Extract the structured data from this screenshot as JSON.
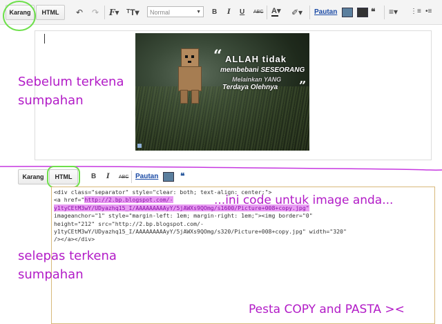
{
  "toolbar_top": {
    "compose_tab": "Karang",
    "html_tab": "HTML",
    "font_select": "Normal",
    "link_label": "Pautan",
    "icons": [
      "undo-icon",
      "redo-icon",
      "font-family-icon",
      "font-size-icon",
      "bold-icon",
      "italic-icon",
      "underline-icon",
      "strikethrough-icon",
      "text-color-icon",
      "highlight-icon",
      "link-icon",
      "image-icon",
      "video-icon",
      "align-icon",
      "numbered-list-icon",
      "bulleted-list-icon"
    ]
  },
  "photo": {
    "quote_line1": "ALLAH tidak",
    "quote_line2": "membebani SESEORANG",
    "quote_line3": "Melainkan YANG",
    "quote_line4": "Terdaya Olehnya"
  },
  "annotations": {
    "before_line1": "Sebelum terkena",
    "before_line2": "sumpahan",
    "after_line1": "selepas terkena",
    "after_line2": "sumpahan",
    "code_note": "...ini code untuk image anda...",
    "copy_paste": "Pesta COPY and PASTA ><"
  },
  "toolbar_bottom": {
    "compose_tab": "Karang",
    "html_tab": "HTML",
    "link_label": "Pautan"
  },
  "code": {
    "line1": "<div class=\"separator\" style=\"clear: both; text-align: center;\">",
    "line2a": "<a href=\"",
    "line2b": "http://2.bp.blogspot.com/-",
    "line3": "y1tyCEtM3wY/UDyazhq15_I/AAAAAAAAAyY/5jAWXs9QOmg/s1600/Picture+008+copy.jpg\"",
    "line4": "imageanchor=\"1\" style=\"margin-left: 1em; margin-right: 1em;\"><img border=\"0\"",
    "line5": "height=\"212\" src=\"http://2.bp.blogspot.com/-",
    "line6": "y1tyCEtM3wY/UDyazhq15_I/AAAAAAAAAyY/5jAWXs9QOmg/s320/Picture+008+copy.jpg\" width=\"320\"",
    "line7": "/></a></div>"
  },
  "colors": {
    "annotation": "#b21bc7",
    "highlight": "#e89cf2",
    "circle": "#6de04a",
    "link": "#1a4aa5"
  }
}
